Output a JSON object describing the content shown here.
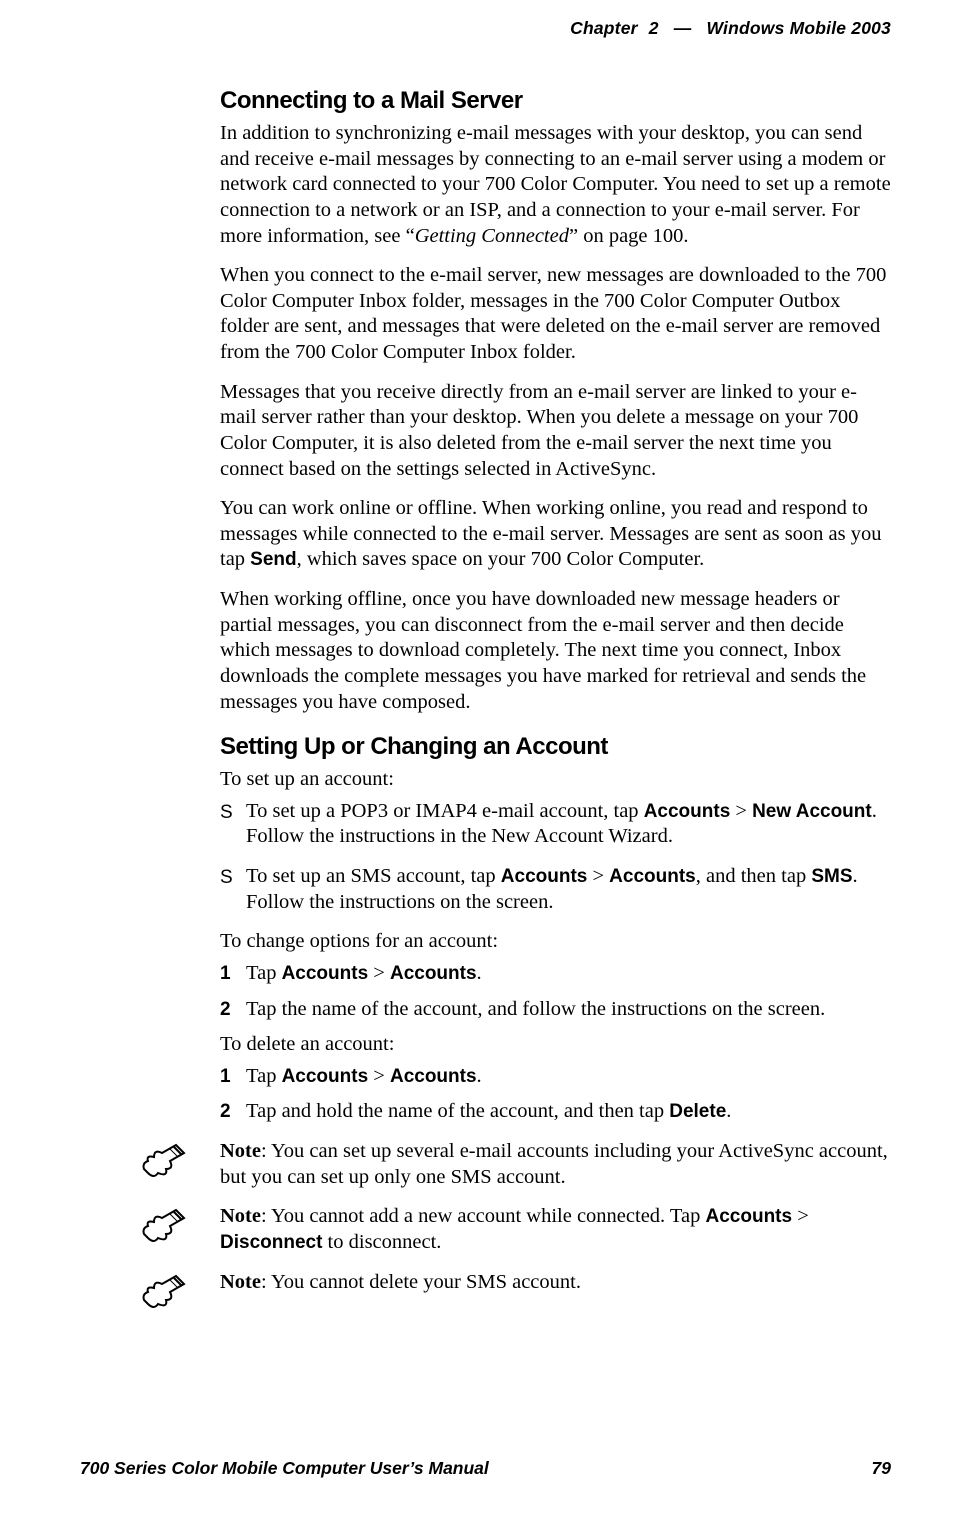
{
  "header": {
    "chapter": "Chapter",
    "chapter_num": "2",
    "dash": "—",
    "title": "Windows Mobile 2003"
  },
  "s1": {
    "heading": "Connecting to a Mail Server",
    "p1a": "In addition to synchronizing e-mail messages with your desktop, you can send and receive e-mail messages by connecting to an e-mail server using a modem or network card connected to your 700 Color Computer. You need to set up a remote connection to a network or an ISP, and a connection to your e-mail server. For more information, see “",
    "p1b": "Getting Connected",
    "p1c": "” on page 100.",
    "p2": "When you connect to the e-mail server, new messages are downloaded to the 700 Color Computer Inbox folder, messages in the 700 Color Computer Outbox folder are sent, and messages that were deleted on the e-mail server are removed from the 700 Color Computer Inbox folder.",
    "p3": "Messages that you receive directly from an e-mail server are linked to your e-mail server rather than your desktop. When you delete a message on your 700 Color Computer, it is also deleted from the e-mail server the next time you connect based on the settings selected in ActiveSync.",
    "p4a": "You can work online or offline. When working online, you read and respond to messages while connected to the e-mail server. Messages are sent as soon as you tap ",
    "p4b": "Send",
    "p4c": ", which saves space on your 700 Color Computer.",
    "p5": "When working offline, once you have downloaded new message headers or partial messages, you can disconnect from the e-mail server and then decide which messages to download completely. The next time you connect, Inbox downloads the complete messages you have marked for retrieval and sends the messages you have composed."
  },
  "s2": {
    "heading": "Setting Up or Changing an Account",
    "intro1": "To set up an account:",
    "b1a": "To set up a POP3 or IMAP4 e-mail account, tap ",
    "b1b": "Accounts",
    "b1c": " > ",
    "b1d": "New Account",
    "b1e": ". Follow the instructions in the New Account Wizard.",
    "b2a": "To set up an SMS account, tap ",
    "b2b": "Accounts",
    "b2c": " > ",
    "b2d": "Accounts",
    "b2e": ", and then tap ",
    "b2f": "SMS",
    "b2g": ". Follow the instructions on the screen.",
    "intro2": "To change options for an account:",
    "c1a": "Tap ",
    "c1b": "Accounts",
    "c1c": " > ",
    "c1d": "Accounts",
    "c1e": ".",
    "c2": "Tap the name of the account, and follow the instructions on the screen.",
    "intro3": "To delete an account:",
    "d1a": "Tap ",
    "d1b": "Accounts",
    "d1c": " > ",
    "d1d": "Accounts",
    "d1e": ".",
    "d2a": "Tap and hold the name of the account, and then tap ",
    "d2b": "Delete",
    "d2c": "."
  },
  "notes": {
    "label": "Note",
    "n1": ": You can set up several e-mail accounts including your ActiveSync account, but you can set up only one SMS account.",
    "n2a": ": You cannot add a new account while connected. Tap ",
    "n2b": "Accounts",
    "n2c": " > ",
    "n2d": "Disconnect",
    "n2e": " to disconnect.",
    "n3": ": You cannot delete your SMS account."
  },
  "footer": {
    "manual": "700 Series Color Mobile Computer User’s Manual",
    "page": "79"
  }
}
